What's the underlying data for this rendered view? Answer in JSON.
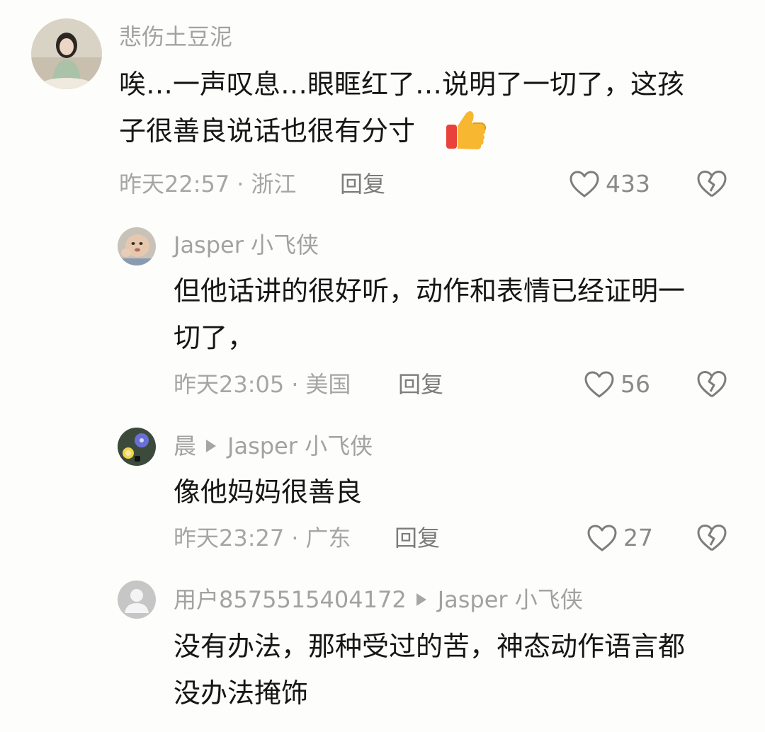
{
  "comments": [
    {
      "username": "悲伤土豆泥",
      "text_lines": [
        "唉…一声叹息…眼眶红了…说明了一切了，这孩",
        "子很善良说话也很有分寸"
      ],
      "emoji": "thumbs-up-icon",
      "time": "昨天22:57",
      "location": "浙江",
      "reply_label": "回复",
      "likes": "433"
    },
    {
      "username": "Jasper 小飞侠",
      "text_lines": [
        "但他话讲的很好听，动作和表情已经证明一",
        "切了，"
      ],
      "time": "昨天23:05",
      "location": "美国",
      "reply_label": "回复",
      "likes": "56"
    },
    {
      "username": "晨",
      "reply_to": "Jasper 小飞侠",
      "text_lines": [
        "像他妈妈很善良"
      ],
      "time": "昨天23:27",
      "location": "广东",
      "reply_label": "回复",
      "likes": "27"
    },
    {
      "username": "用户8575515404172",
      "reply_to": "Jasper 小飞侠",
      "text_lines": [
        "没有办法，那种受过的苦，神态动作语言都",
        "没办法掩饰"
      ]
    }
  ],
  "meta_separator": "·",
  "colors": {
    "background": "#fdfdfb",
    "username": "#a2a2a2",
    "text": "#161616",
    "meta": "#a6a6a6",
    "reply": "#7c7c7c"
  }
}
